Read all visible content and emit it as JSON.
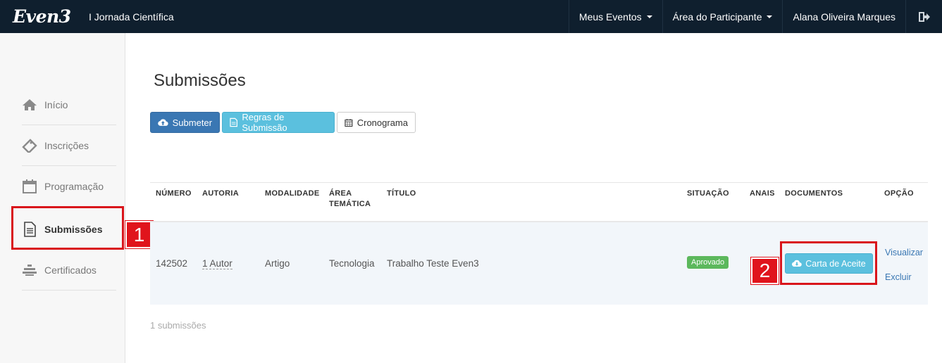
{
  "topbar": {
    "logo": "Even3",
    "event_title": "I Jornada Científica",
    "nav": [
      {
        "label": "Meus Eventos"
      },
      {
        "label": "Área do Participante"
      },
      {
        "label": "Alana Oliveira Marques"
      }
    ],
    "logout_icon": "sign-out-icon"
  },
  "sidebar": {
    "items": [
      {
        "label": "Início",
        "icon": "home-icon"
      },
      {
        "label": "Inscrições",
        "icon": "ticket-icon"
      },
      {
        "label": "Programação",
        "icon": "calendar-icon"
      },
      {
        "label": "Submissões",
        "icon": "document-icon",
        "active": true
      },
      {
        "label": "Certificados",
        "icon": "certificate-icon"
      }
    ]
  },
  "annotations": {
    "badge1": "1",
    "badge2": "2",
    "highlight_color": "#d9151b"
  },
  "main": {
    "title": "Submissões",
    "buttons": {
      "submeter": "Submeter",
      "regras": "Regras de Submissão",
      "cronograma": "Cronograma"
    },
    "table": {
      "headers": {
        "numero": "NÚMERO",
        "autoria": "AUTORIA",
        "modalidade": "MODALIDADE",
        "area_line1": "ÁREA",
        "area_line2": "TEMÁTICA",
        "titulo": "TÍTULO",
        "situacao": "SITUAÇÃO",
        "anais": "ANAIS",
        "documentos": "DOCUMENTOS",
        "opcao": "OPÇÃO"
      },
      "rows": [
        {
          "numero": "142502",
          "autoria": "1 Autor",
          "modalidade": "Artigo",
          "area": "Tecnologia",
          "titulo": "Trabalho Teste Even3",
          "situacao": "Aprovado",
          "documento_button": "Carta de Aceite",
          "opcao_visualizar": "Visualizar",
          "opcao_excluir": "Excluir"
        }
      ]
    },
    "count_text": "1 submissões"
  },
  "colors": {
    "topbar": "#0f1f2e",
    "primary": "#3a77b3",
    "info": "#5bc0de",
    "success": "#5cb85c"
  }
}
